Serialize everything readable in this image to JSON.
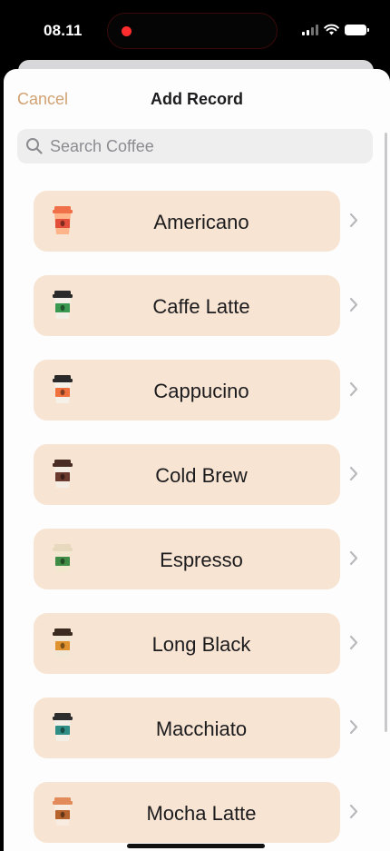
{
  "status": {
    "time": "08.11"
  },
  "nav": {
    "cancel_label": "Cancel",
    "title": "Add Record"
  },
  "search": {
    "placeholder": "Search Coffee",
    "value": ""
  },
  "coffees": [
    {
      "name": "Americano",
      "icon": "coffee-cup-icon",
      "lid_color": "#f0704a",
      "cup_color": "#ffb48a",
      "band_color": "#e34f3a"
    },
    {
      "name": "Caffe Latte",
      "icon": "coffee-cup-icon",
      "lid_color": "#2a2a2a",
      "cup_color": "#f4efe6",
      "band_color": "#3a9a52"
    },
    {
      "name": "Cappucino",
      "icon": "coffee-cup-icon",
      "lid_color": "#2a2a2a",
      "cup_color": "#f5f0e8",
      "band_color": "#f0713e"
    },
    {
      "name": "Cold Brew",
      "icon": "coffee-cup-icon",
      "lid_color": "#4a2e25",
      "cup_color": "#f4ede4",
      "band_color": "#6b3a2e"
    },
    {
      "name": "Espresso",
      "icon": "coffee-cup-icon",
      "lid_color": "#e6d9bd",
      "cup_color": "#f2e8cf",
      "band_color": "#3f8c46"
    },
    {
      "name": "Long Black",
      "icon": "coffee-cup-icon",
      "lid_color": "#3a2a20",
      "cup_color": "#f1e6d3",
      "band_color": "#e0922e"
    },
    {
      "name": "Macchiato",
      "icon": "coffee-cup-icon",
      "lid_color": "#2d2d2d",
      "cup_color": "#f3eee6",
      "band_color": "#2f8f86"
    },
    {
      "name": "Mocha Latte",
      "icon": "coffee-cup-icon",
      "lid_color": "#e38a5a",
      "cup_color": "#f7ecdf",
      "band_color": "#b8642f"
    }
  ],
  "colors": {
    "accent": "#d1a273",
    "row_background": "#f8e4d3",
    "chevron": "#b9b9bd"
  }
}
